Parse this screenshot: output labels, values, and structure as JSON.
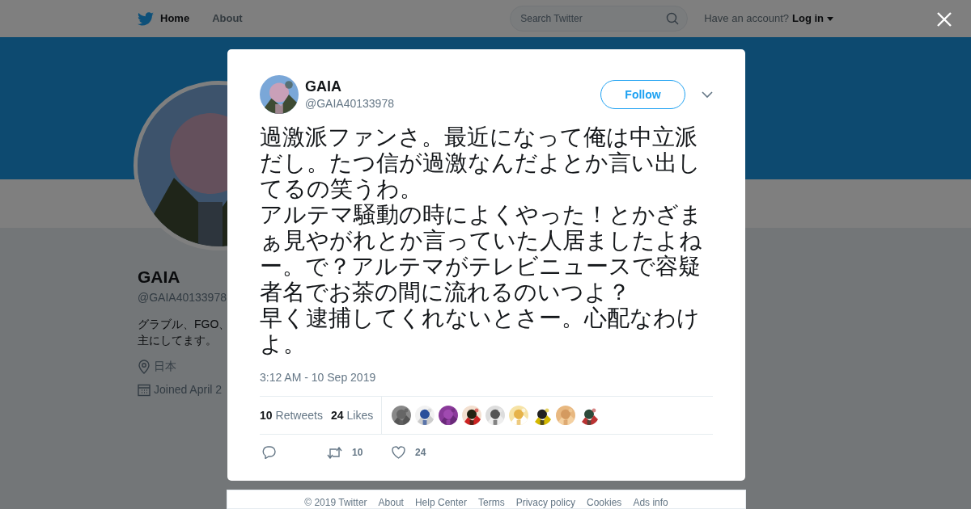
{
  "header": {
    "nav": [
      {
        "label": "Home"
      },
      {
        "label": "About"
      }
    ],
    "search": {
      "placeholder": "Search Twitter"
    },
    "account_prompt": "Have an account?",
    "login": "Log in"
  },
  "profile": {
    "name": "GAIA",
    "handle": "@GAIA40133978",
    "bio": [
      "グラブル、FGO、",
      "主にしてます。"
    ],
    "location": "日本",
    "joined": "Joined April 2"
  },
  "tweet": {
    "name": "GAIA",
    "handle": "@GAIA40133978",
    "follow": "Follow",
    "text": [
      "過激派ファンさ。最近になって俺は中立派だし。たつ信が過激なんだよとか言い出してるの笑うわ。",
      "アルテマ騒動の時によくやった！とかざまぁ見やがれとか言っていた人居ましたよねー。で？アルテマがテレビニュースで容疑者名でお茶の間に流れるのいつよ？",
      "早く逮捕してくれないとさー。心配なわけよ。"
    ],
    "timestamp": "3:12 AM - 10 Sep 2019",
    "stats": [
      {
        "count": "10",
        "label": "Retweets"
      },
      {
        "count": "24",
        "label": "Likes"
      }
    ],
    "actions": [
      {
        "kind": "reply"
      },
      {
        "kind": "retweet",
        "count": "10"
      },
      {
        "kind": "like",
        "count": "24"
      }
    ]
  },
  "footer": [
    "© 2019 Twitter",
    "About",
    "Help Center",
    "Terms",
    "Privacy policy",
    "Cookies",
    "Ads info"
  ]
}
